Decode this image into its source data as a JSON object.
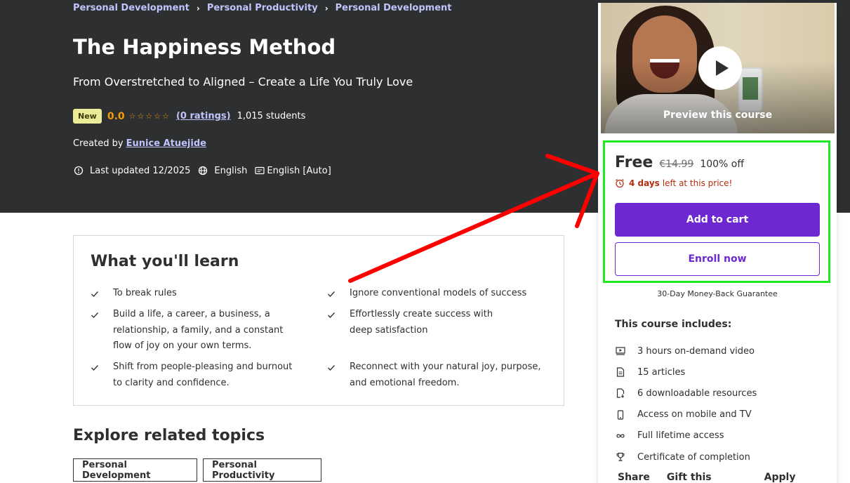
{
  "breadcrumb": [
    "Personal Development",
    "Personal Productivity",
    "Personal Development"
  ],
  "course": {
    "title": "The Happiness Method",
    "subtitle": "From Overstretched to Aligned – Create a Life You Truly Love",
    "badge": "New",
    "rating": "0.0",
    "stars": "☆☆☆☆☆",
    "ratings_count": "(0 ratings)",
    "students": "1,015 students",
    "created_prefix": "Created by",
    "instructor": "Eunice Atuejide",
    "last_updated": "Last updated 12/2025",
    "language": "English",
    "captions": "English [Auto]"
  },
  "sidebar": {
    "preview_label": "Preview this course",
    "price": "Free",
    "original_price": "€14.99",
    "discount": "100% off",
    "timer_bold": "4 days",
    "timer_rest": "left at this price!",
    "add_to_cart": "Add to cart",
    "enroll_now": "Enroll now",
    "guarantee": "30-Day Money-Back Guarantee",
    "includes_title": "This course includes:",
    "includes": [
      {
        "icon": "video-icon",
        "label": "3 hours on-demand video"
      },
      {
        "icon": "article-icon",
        "label": "15 articles"
      },
      {
        "icon": "download-file-icon",
        "label": "6 downloadable resources"
      },
      {
        "icon": "mobile-icon",
        "label": "Access on mobile and TV"
      },
      {
        "icon": "infinity-icon",
        "label": "Full lifetime access"
      },
      {
        "icon": "trophy-icon",
        "label": "Certificate of completion"
      }
    ],
    "footer": {
      "share": "Share",
      "gift": "Gift this course",
      "coupon": "Apply Coupon"
    }
  },
  "learn": {
    "title": "What you'll learn",
    "items": [
      "To break rules",
      "Ignore conventional models of success",
      "Build a life, a career, a business, a relationship, a family, and a constant flow of joy on your own terms.",
      "Effortlessly create success with deep satisfaction",
      "Shift from people-pleasing and burnout to clarity and confidence.",
      "Reconnect with your natural joy, purpose, and emotional freedom."
    ]
  },
  "explore": {
    "title": "Explore related topics",
    "topics": [
      "Personal Development",
      "Personal Productivity"
    ]
  },
  "colors": {
    "hero_bg": "#2d2f31",
    "accent": "#6d28d2",
    "link_light": "#c0c4fc",
    "star": "#f69c08",
    "timer": "#b32d0f",
    "annotation_arrow": "#ff0000",
    "annotation_box": "#1ee822"
  }
}
